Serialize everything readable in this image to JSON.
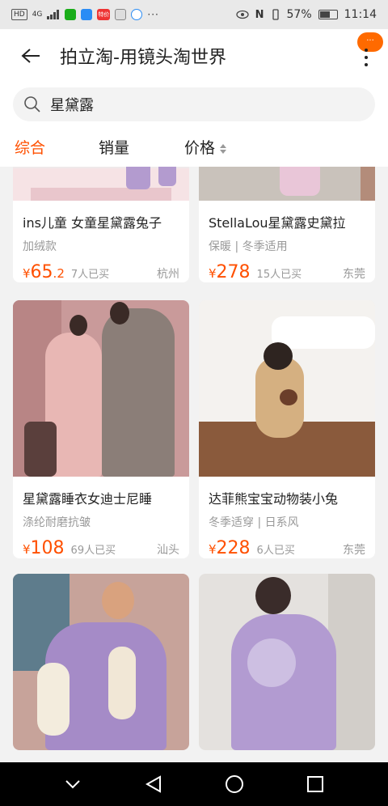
{
  "status_bar": {
    "network": "HD",
    "signal_label": "4G",
    "battery": "57%",
    "time": "11:14",
    "app_badge": "特价"
  },
  "header": {
    "title": "拍立淘-用镜头淘世界",
    "badge": "···"
  },
  "search": {
    "value": "星黛露"
  },
  "tabs": [
    {
      "label": "综合"
    },
    {
      "label": "销量"
    },
    {
      "label": "价格"
    }
  ],
  "products": [
    {
      "name": "ins儿童 女童星黛露兔子",
      "tags": "加绒款",
      "currency": "¥",
      "price_int": "65",
      "price_dec": ".2",
      "sold": "7人已买",
      "location": "杭州"
    },
    {
      "name": "StellaLou星黛露史黛拉",
      "tags": "保暖 | 冬季适用",
      "currency": "¥",
      "price_int": "278",
      "price_dec": "",
      "sold": "15人已买",
      "location": "东莞"
    },
    {
      "name": "星黛露睡衣女迪士尼睡",
      "tags": "涤纶耐磨抗皱",
      "currency": "¥",
      "price_int": "108",
      "price_dec": "",
      "sold": "69人已买",
      "location": "汕头"
    },
    {
      "name": "达菲熊宝宝动物装小兔",
      "tags": "冬季适穿 | 日系风",
      "currency": "¥",
      "price_int": "228",
      "price_dec": "",
      "sold": "6人已买",
      "location": "东莞"
    }
  ],
  "colors": {
    "accent": "#ff5000",
    "muted": "#999999"
  }
}
